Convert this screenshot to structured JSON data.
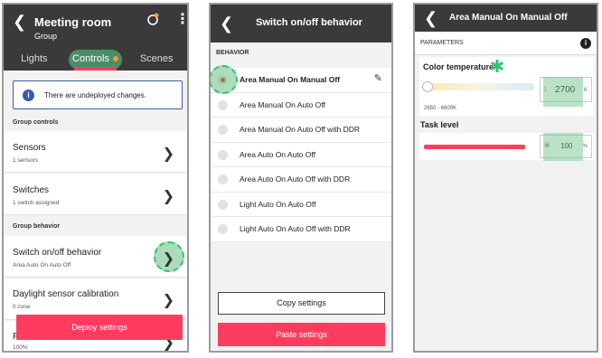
{
  "screen1": {
    "title": "Meeting room",
    "subtitle": "Group",
    "tabs": [
      "Lights",
      "Controls",
      "Scenes"
    ],
    "notice": "There are undeployed changes.",
    "section_controls": "Group controls",
    "rows": [
      {
        "title": "Sensors",
        "sub": "1 sensors"
      },
      {
        "title": "Switches",
        "sub": "1 switch assigned"
      }
    ],
    "section_behavior": "Group behavior",
    "behavior_rows": [
      {
        "title": "Switch on/off behavior",
        "sub": "Area Auto On Auto Off"
      },
      {
        "title": "Daylight sensor calibration",
        "sub": "0 zone"
      }
    ],
    "deploy_label": "Deploy settings",
    "last_row_sub": "100%",
    "last_row_partial": "P"
  },
  "screen2": {
    "title": "Switch on/off behavior",
    "section": "BEHAVIOR",
    "options": [
      "Area Manual On Manual Off",
      "Area Manual On Auto Off",
      "Area Manual On Auto Off with DDR",
      "Area Auto On Auto Off",
      "Area Auto On Auto Off with DDR",
      "Light Auto On Auto Off",
      "Light Auto On Auto Off with DDR"
    ],
    "selected_index": 0,
    "copy_label": "Copy settings",
    "paste_label": "Paste settings"
  },
  "screen3": {
    "title": "Area Manual On Manual Off",
    "params_label": "PARAMETERS",
    "color_temp_label": "Color temperature",
    "color_temp_value": "2700",
    "color_temp_unit": "K",
    "color_temp_range": "2650 - 6600K",
    "task_level_label": "Task level",
    "task_level_value": "100",
    "task_level_unit": "%"
  },
  "colors": {
    "accent": "#ff3c5f",
    "topbar": "#3a3a3a",
    "highlight": "#2ec46d"
  }
}
